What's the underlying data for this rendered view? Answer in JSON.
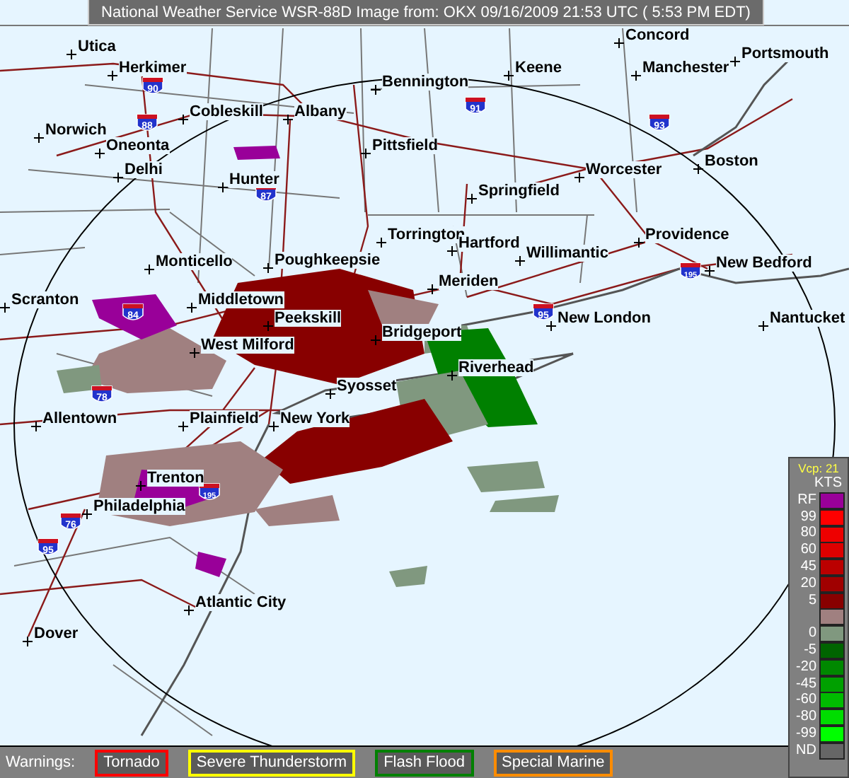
{
  "header": {
    "title": "National Weather Service WSR-88D Image from: OKX 09/16/2009 21:53 UTC ( 5:53 PM EDT)"
  },
  "map": {
    "cities": [
      {
        "name": "Concord"
      },
      {
        "name": "Utica"
      },
      {
        "name": "Portsmouth"
      },
      {
        "name": "Herkimer"
      },
      {
        "name": "Keene"
      },
      {
        "name": "Manchester"
      },
      {
        "name": "Bennington"
      },
      {
        "name": "Cobleskill"
      },
      {
        "name": "Albany"
      },
      {
        "name": "Norwich"
      },
      {
        "name": "Oneonta"
      },
      {
        "name": "Pittsfield"
      },
      {
        "name": "Boston"
      },
      {
        "name": "Delhi"
      },
      {
        "name": "Worcester"
      },
      {
        "name": "Hunter"
      },
      {
        "name": "Springfield"
      },
      {
        "name": "Torrington"
      },
      {
        "name": "Providence"
      },
      {
        "name": "Hartford"
      },
      {
        "name": "Willimantic"
      },
      {
        "name": "Monticello"
      },
      {
        "name": "Poughkeepsie"
      },
      {
        "name": "New Bedford"
      },
      {
        "name": "Meriden"
      },
      {
        "name": "Scranton"
      },
      {
        "name": "Middletown"
      },
      {
        "name": "Peekskill"
      },
      {
        "name": "New London"
      },
      {
        "name": "Nantucket"
      },
      {
        "name": "Bridgeport"
      },
      {
        "name": "West Milford"
      },
      {
        "name": "Riverhead"
      },
      {
        "name": "Syosset"
      },
      {
        "name": "Allentown"
      },
      {
        "name": "Plainfield"
      },
      {
        "name": "New York"
      },
      {
        "name": "Trenton"
      },
      {
        "name": "Philadelphia"
      },
      {
        "name": "Atlantic City"
      },
      {
        "name": "Dover"
      }
    ],
    "highway_shields": [
      {
        "number": "90"
      },
      {
        "number": "88"
      },
      {
        "number": "87"
      },
      {
        "number": "91"
      },
      {
        "number": "93"
      },
      {
        "number": "84"
      },
      {
        "number": "95"
      },
      {
        "number": "195"
      },
      {
        "number": "78"
      },
      {
        "number": "195"
      },
      {
        "number": "76"
      },
      {
        "number": "95"
      }
    ]
  },
  "legend": {
    "mode": "Vcp: 21",
    "units": "KTS",
    "items": [
      {
        "label": "RF",
        "color": "#990099"
      },
      {
        "label": "99",
        "color": "#ff0000"
      },
      {
        "label": "80",
        "color": "#ee0000"
      },
      {
        "label": "60",
        "color": "#dd0000"
      },
      {
        "label": "45",
        "color": "#bb0000"
      },
      {
        "label": "20",
        "color": "#a00000"
      },
      {
        "label": "5",
        "color": "#880000"
      },
      {
        "color": "#a08080"
      },
      {
        "label": "0",
        "color": "#80987f"
      },
      {
        "label": "-5",
        "color": "#006400"
      },
      {
        "label": "-20",
        "color": "#008800"
      },
      {
        "label": "-45",
        "color": "#00a000"
      },
      {
        "label": "-60",
        "color": "#00bb00"
      },
      {
        "label": "-80",
        "color": "#00dd00"
      },
      {
        "label": "-99",
        "color": "#00ff00"
      },
      {
        "label": "ND",
        "color": "#666666"
      }
    ]
  },
  "warnings": {
    "label": "Warnings:",
    "items": [
      {
        "label": "Tornado",
        "color": "#ff0000"
      },
      {
        "label": "Severe Thunderstorm",
        "color": "#ffff00"
      },
      {
        "label": "Flash Flood",
        "color": "#008000"
      },
      {
        "label": "Special Marine",
        "color": "#ff8c00"
      }
    ]
  }
}
